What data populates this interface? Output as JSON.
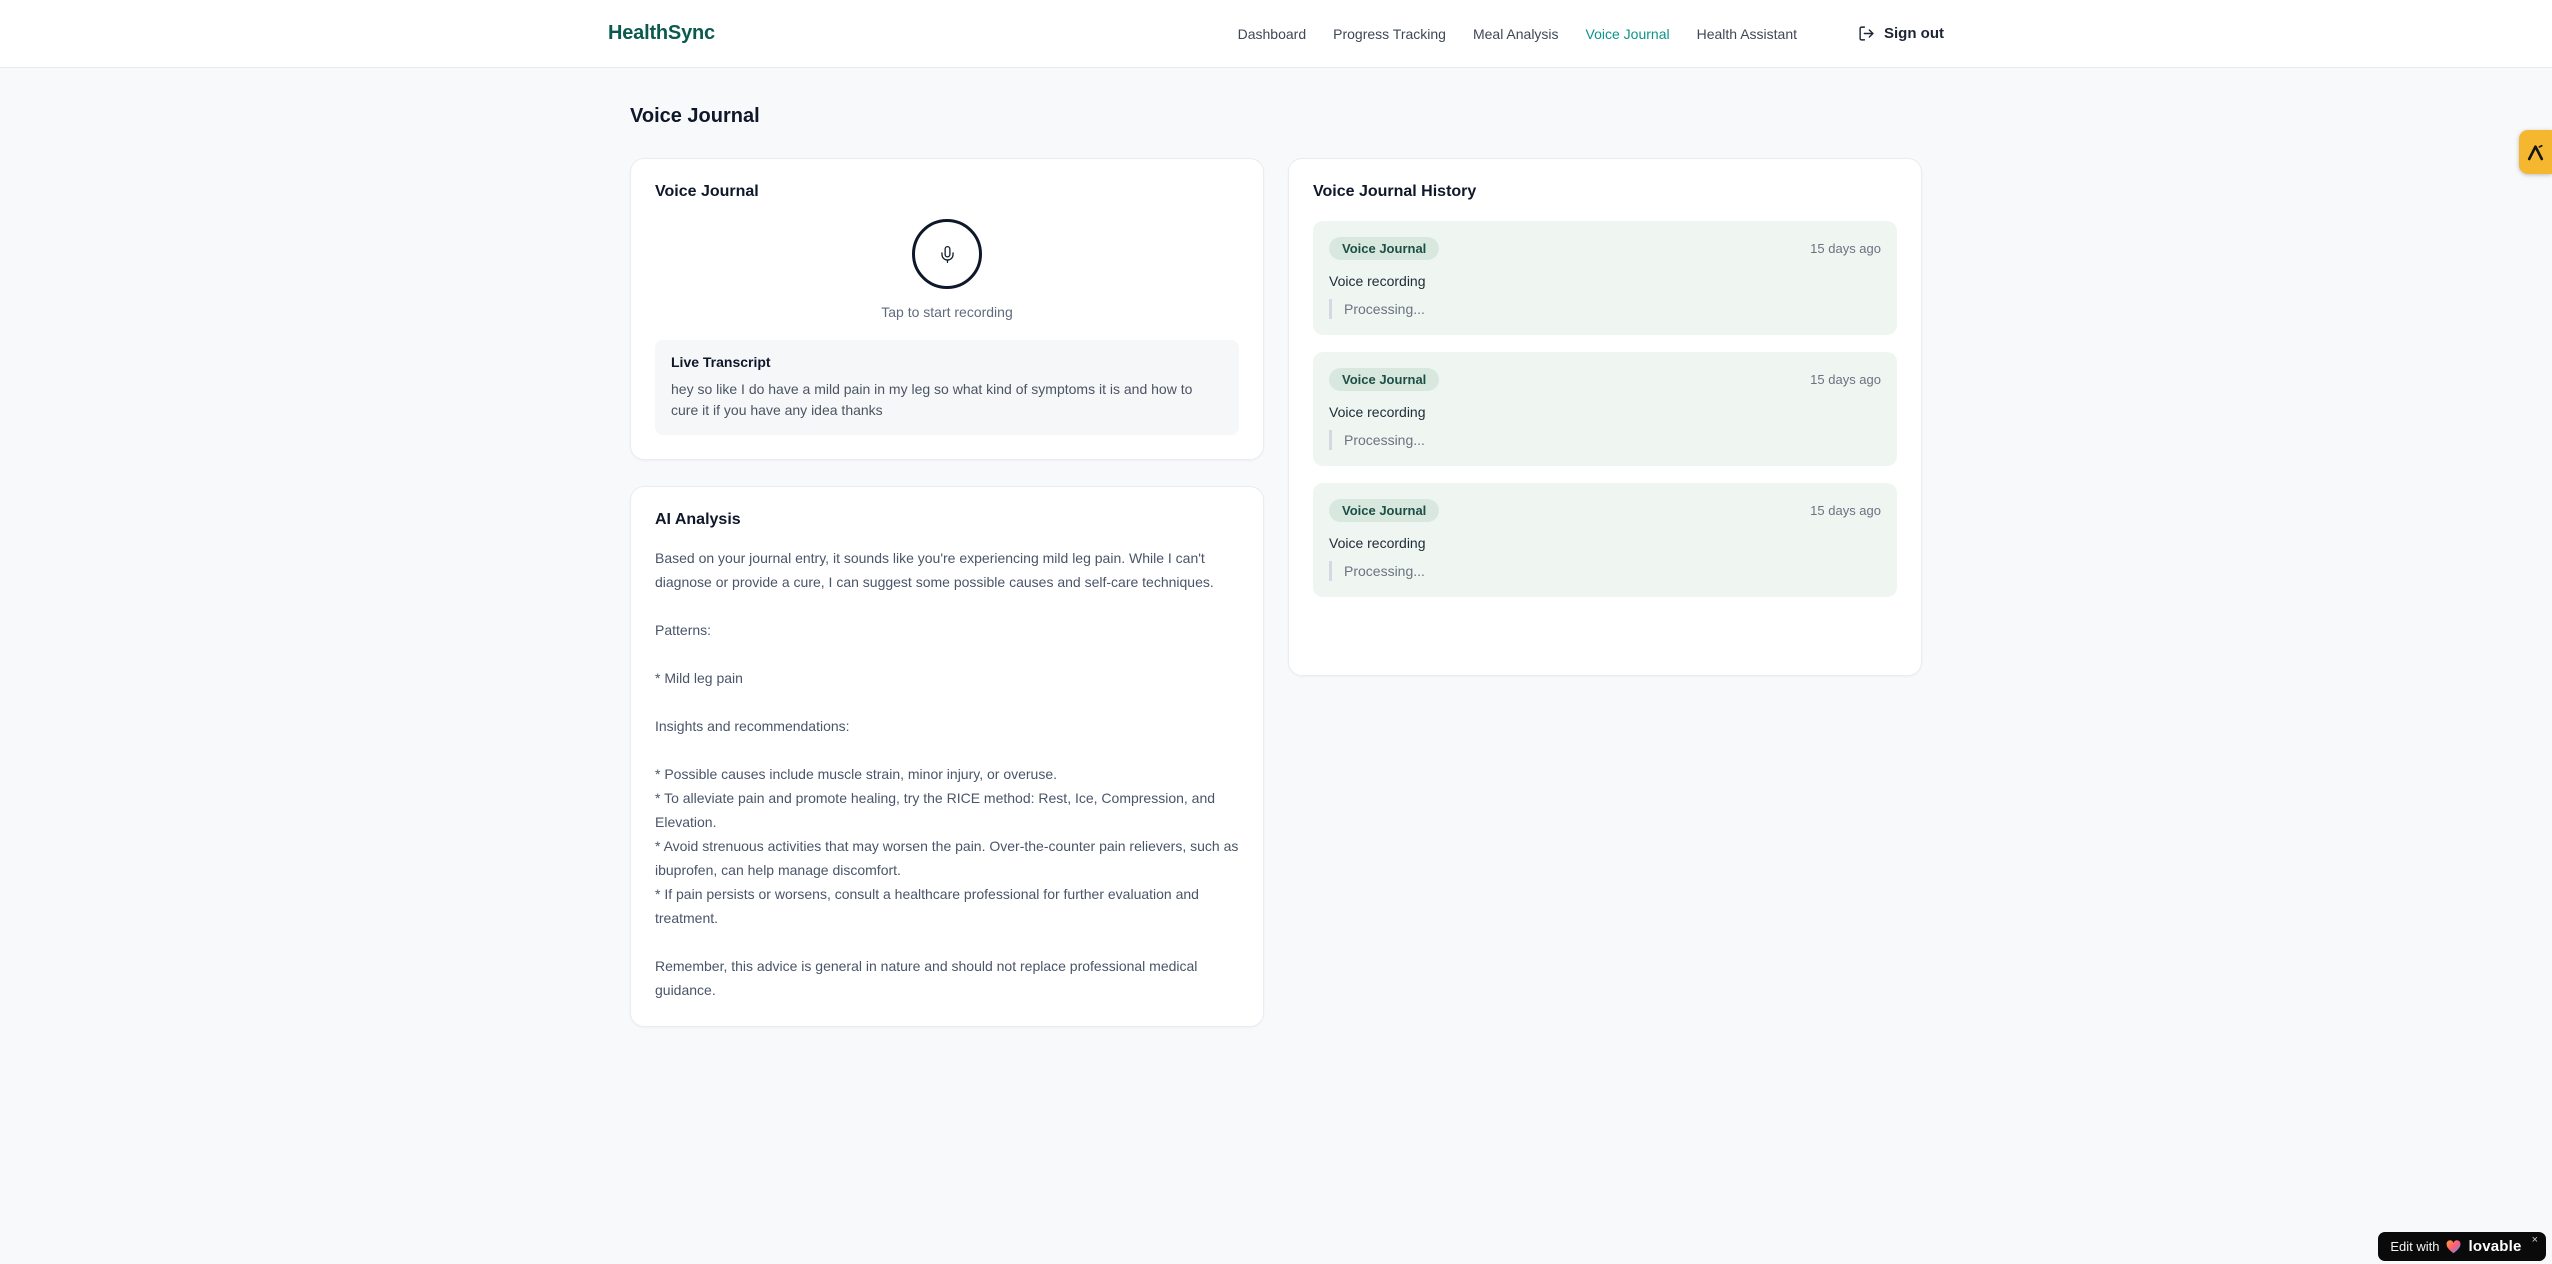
{
  "brand": {
    "name": "HealthSync"
  },
  "nav": {
    "items": [
      {
        "label": "Dashboard"
      },
      {
        "label": "Progress Tracking"
      },
      {
        "label": "Meal Analysis"
      },
      {
        "label": "Voice Journal",
        "active": true
      },
      {
        "label": "Health Assistant"
      }
    ],
    "sign_out_label": "Sign out"
  },
  "page": {
    "title": "Voice Journal"
  },
  "recorder_card": {
    "title": "Voice Journal",
    "mic_icon": "microphone-icon",
    "tap_hint": "Tap to start recording",
    "transcript": {
      "title": "Live Transcript",
      "text": "hey so like I do have a mild pain in my leg so what kind of symptoms it is and how to cure it if you have any idea thanks"
    }
  },
  "analysis_card": {
    "title": "AI Analysis",
    "body": "Based on your journal entry, it sounds like you're experiencing mild leg pain. While I can't diagnose or provide a cure, I can suggest some possible causes and self-care techniques.\n\nPatterns:\n\n* Mild leg pain\n\nInsights and recommendations:\n\n* Possible causes include muscle strain, minor injury, or overuse.\n* To alleviate pain and promote healing, try the RICE method: Rest, Ice, Compression, and Elevation.\n* Avoid strenuous activities that may worsen the pain. Over-the-counter pain relievers, such as ibuprofen, can help manage discomfort.\n* If pain persists or worsens, consult a healthcare professional for further evaluation and treatment.\n\nRemember, this advice is general in nature and should not replace professional medical guidance."
  },
  "history_card": {
    "title": "Voice Journal History",
    "items": [
      {
        "badge": "Voice Journal",
        "time": "15 days ago",
        "label": "Voice recording",
        "status": "Processing..."
      },
      {
        "badge": "Voice Journal",
        "time": "15 days ago",
        "label": "Voice recording",
        "status": "Processing..."
      },
      {
        "badge": "Voice Journal",
        "time": "15 days ago",
        "label": "Voice recording",
        "status": "Processing..."
      }
    ]
  },
  "lovable_badge": {
    "prefix": "Edit with",
    "brand": "lovable",
    "close": "×"
  },
  "colors": {
    "brand_teal": "#0c5a4e",
    "accent_teal": "#0d9488",
    "history_item_bg": "#eff6f1",
    "history_badge_bg": "#d9e8de",
    "side_badge_amber": "#f5b72f",
    "lovable_bg": "#0a0a0b"
  }
}
